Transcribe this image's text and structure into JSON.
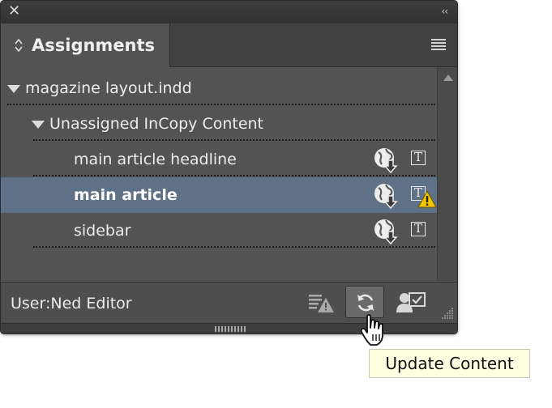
{
  "panel": {
    "tab_title": "Assignments"
  },
  "tree": {
    "document": "magazine layout.indd",
    "group": "Unassigned InCopy Content",
    "items": [
      {
        "label": "main article headline",
        "selected": false,
        "warning": false
      },
      {
        "label": "main article",
        "selected": true,
        "warning": true
      },
      {
        "label": "sidebar",
        "selected": false,
        "warning": false
      }
    ]
  },
  "footer": {
    "user": "User:Ned Editor"
  },
  "tooltip": {
    "text": "Update Content"
  },
  "icons": {
    "close": "close-icon",
    "collapse": "double-chevron-left-icon",
    "panel_menu": "hamburger-menu-icon",
    "globe_download": "globe-download-icon",
    "text_frame": "text-frame-icon",
    "warning": "warning-icon",
    "update": "refresh-icon",
    "user": "user-assignment-icon"
  },
  "colors": {
    "panel_bg": "#535353",
    "selection": "#5e7187",
    "tooltip_bg": "#ffffe1",
    "warning": "#f2c400"
  }
}
